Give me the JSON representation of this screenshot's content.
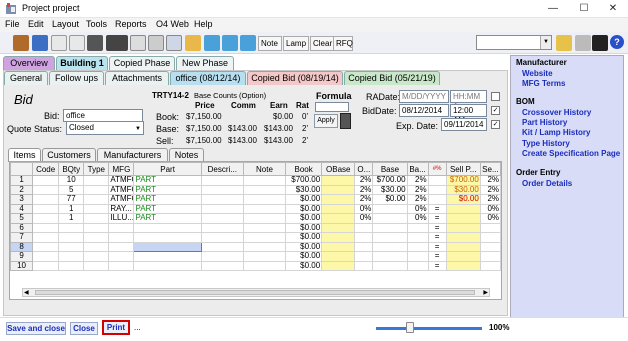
{
  "window": {
    "title": "Project project",
    "minimize": "—",
    "maximize": "☐",
    "close": "✕"
  },
  "menu": [
    "File",
    "Edit",
    "Layout",
    "Tools",
    "Reports",
    "O4 Web",
    "Help"
  ],
  "toolbar": {
    "text_buttons": [
      "Note",
      "Lamp",
      "Clear",
      "RFQ"
    ]
  },
  "main_tabs": [
    "Overview",
    "Building 1",
    "Copied Phase",
    "New Phase"
  ],
  "sub_tabs": [
    "General",
    "Follow ups",
    "Attachments",
    "office (08/12/14)",
    "Copied Bid (08/19/14)",
    "Copied Bid (05/21/19)"
  ],
  "bid": {
    "heading": "Bid",
    "bid_label": "Bid:",
    "bid_value": "office",
    "status_label": "Quote Status:",
    "status_value": "Closed",
    "code": "TRTY14-2",
    "base_counts": "Base Counts (Option)",
    "col_price": "Price",
    "col_comm": "Comm",
    "col_earn": "Earn",
    "col_rat": "Rat",
    "rows": [
      {
        "label": "Book:",
        "price": "$7,150.00",
        "comm": "",
        "earn": "$0.00",
        "rat": "0'"
      },
      {
        "label": "Base:",
        "price": "$7,150.00",
        "comm": "$143.00",
        "earn": "$143.00",
        "rat": "2'"
      },
      {
        "label": "Sell:",
        "price": "$7,150.00",
        "comm": "$143.00",
        "earn": "$143.00",
        "rat": "2'"
      }
    ],
    "formula_label": "Formula",
    "apply_label": "Apply",
    "radate_label": "RADate:",
    "radate_placeholder": "M/DD/YYYY",
    "radate_time_placeholder": "HH:MM A",
    "biddate_label": "BidDate:",
    "biddate_value": "08/12/2014",
    "biddate_time": "12:00 AM",
    "expdate_label": "Exp. Date:",
    "expdate_value": "09/11/2014"
  },
  "grid_tabs": [
    "Items",
    "Customers",
    "Manufacturers",
    "Notes"
  ],
  "grid": {
    "columns": [
      "",
      "Code",
      "BQty",
      "Type",
      "MFG",
      "Part",
      "Descri...",
      "Note",
      "Book",
      "OBase",
      "O...",
      "Base",
      "Ba...",
      "#%",
      "Sell P...",
      "Se..."
    ],
    "rows": [
      {
        "n": "1",
        "code": "",
        "bqty": "10",
        "type": "",
        "mfg": "ATMFG",
        "part": "PART",
        "desc": "",
        "note": "",
        "book": "$700.00",
        "obase": "",
        "o": "2%",
        "base": "$700.00",
        "ba": "2%",
        "pct": "",
        "sell": "$700.00",
        "se": "2%"
      },
      {
        "n": "2",
        "code": "",
        "bqty": "5",
        "type": "",
        "mfg": "ATMFG",
        "part": "PART",
        "desc": "",
        "note": "",
        "book": "$30.00",
        "obase": "",
        "o": "2%",
        "base": "$30.00",
        "ba": "2%",
        "pct": "",
        "sell": "$30.00",
        "se": "2%"
      },
      {
        "n": "3",
        "code": "",
        "bqty": "77",
        "type": "",
        "mfg": "ATMFG",
        "part": "PART",
        "desc": "",
        "note": "",
        "book": "$0.00",
        "obase": "",
        "o": "2%",
        "base": "$0.00",
        "ba": "2%",
        "pct": "",
        "sell": "$0.00",
        "se": "2%"
      },
      {
        "n": "4",
        "code": "",
        "bqty": "1",
        "type": "",
        "mfg": "RAY...",
        "part": "PART",
        "desc": "",
        "note": "",
        "book": "$0.00",
        "obase": "",
        "o": "0%",
        "base": "",
        "ba": "0%",
        "pct": "=",
        "sell": "",
        "se": "0%"
      },
      {
        "n": "5",
        "code": "",
        "bqty": "1",
        "type": "",
        "mfg": "ILLU...",
        "part": "PART",
        "desc": "",
        "note": "",
        "book": "$0.00",
        "obase": "",
        "o": "0%",
        "base": "",
        "ba": "0%",
        "pct": "=",
        "sell": "",
        "se": "0%"
      },
      {
        "n": "6",
        "code": "",
        "bqty": "",
        "type": "",
        "mfg": "",
        "part": "",
        "desc": "",
        "note": "",
        "book": "$0.00",
        "obase": "",
        "o": "",
        "base": "",
        "ba": "",
        "pct": "=",
        "sell": "",
        "se": ""
      },
      {
        "n": "7",
        "code": "",
        "bqty": "",
        "type": "",
        "mfg": "",
        "part": "",
        "desc": "",
        "note": "",
        "book": "$0.00",
        "obase": "",
        "o": "",
        "base": "",
        "ba": "",
        "pct": "=",
        "sell": "",
        "se": ""
      },
      {
        "n": "8",
        "code": "",
        "bqty": "",
        "type": "",
        "mfg": "",
        "part": "",
        "desc": "",
        "note": "",
        "book": "$0.00",
        "obase": "",
        "o": "",
        "base": "",
        "ba": "",
        "pct": "=",
        "sell": "",
        "se": ""
      },
      {
        "n": "9",
        "code": "",
        "bqty": "",
        "type": "",
        "mfg": "",
        "part": "",
        "desc": "",
        "note": "",
        "book": "$0.00",
        "obase": "",
        "o": "",
        "base": "",
        "ba": "",
        "pct": "=",
        "sell": "",
        "se": ""
      },
      {
        "n": "10",
        "code": "",
        "bqty": "",
        "type": "",
        "mfg": "",
        "part": "",
        "desc": "",
        "note": "",
        "book": "$0.00",
        "obase": "",
        "o": "",
        "base": "",
        "ba": "",
        "pct": "=",
        "sell": "",
        "se": ""
      }
    ]
  },
  "right_panel": {
    "sections": [
      {
        "title": "Manufacturer",
        "links": [
          "Website",
          "MFG Terms"
        ]
      },
      {
        "title": "BOM",
        "links": [
          "Crossover History",
          "Part History",
          "Kit / Lamp History",
          "Type History",
          "Create Specification Page"
        ]
      },
      {
        "title": "Order Entry",
        "links": [
          "Order Details"
        ]
      }
    ]
  },
  "bottom": {
    "save_close": "Save and close",
    "close": "Close",
    "print": "Print",
    "ellipsis": "...",
    "zoom": "100%"
  },
  "colors": {
    "selection": "#c7d5f5",
    "accent_red": "#d40000",
    "link_blue": "#1a2dbd",
    "part_green": "#1a8a1a",
    "sell_orange": "#c86400"
  }
}
